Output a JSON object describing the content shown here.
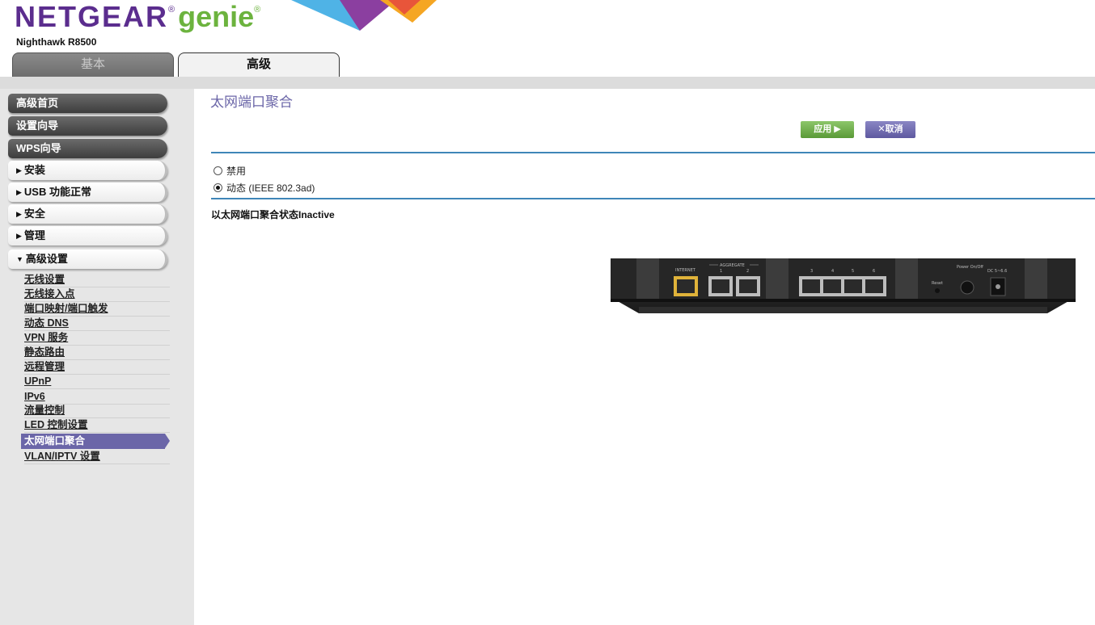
{
  "header": {
    "brand": "NETGEAR",
    "brand_suffix": "genie",
    "registered_mark": "®",
    "model": "Nighthawk R8500",
    "tabs": [
      {
        "label": "基本",
        "active": false
      },
      {
        "label": "高级",
        "active": true
      }
    ]
  },
  "sidebar": {
    "main_buttons": [
      {
        "label": "高级首页"
      },
      {
        "label": "设置向导"
      },
      {
        "label": "WPS向导"
      }
    ],
    "sections": [
      {
        "label": "安装",
        "expanded": false
      },
      {
        "label": "USB 功能正常",
        "expanded": false
      },
      {
        "label": "安全",
        "expanded": false
      },
      {
        "label": "管理",
        "expanded": false
      },
      {
        "label": "高级设置",
        "expanded": true
      }
    ],
    "sub_items": [
      "无线设置",
      "无线接入点",
      "端口映射/端口触发",
      "动态 DNS",
      "VPN 服务",
      "静态路由",
      "远程管理",
      "UPnP",
      "IPv6",
      "流量控制",
      "LED 控制设置",
      "太网端口聚合",
      "VLAN/IPTV 设置"
    ],
    "active_sub_index": 11
  },
  "main": {
    "title": "太网端口聚合",
    "apply_label": "应用 ▶",
    "cancel_label": "✕取消",
    "options": [
      {
        "label": "禁用",
        "checked": false
      },
      {
        "label": "动态 (IEEE 802.3ad)",
        "checked": true
      }
    ],
    "status_text": "以太网端口聚合状态Inactive",
    "router_labels": {
      "internet": "INTERNET",
      "aggregate": "AGGREGATE",
      "agg_ports": [
        "1",
        "2"
      ],
      "lan_ports": [
        "3",
        "4",
        "5",
        "6"
      ],
      "reset": "Reset",
      "power": "Power On/Off",
      "dc": "DC 5~6.6"
    }
  },
  "colors": {
    "brand_purple": "#5b2d8e",
    "brand_green": "#6cb33e",
    "accent_purple": "#6b66a8",
    "rule_blue": "#3f86b8",
    "apply_green": "#6aaa45",
    "internet_port": "#e0b33a"
  }
}
